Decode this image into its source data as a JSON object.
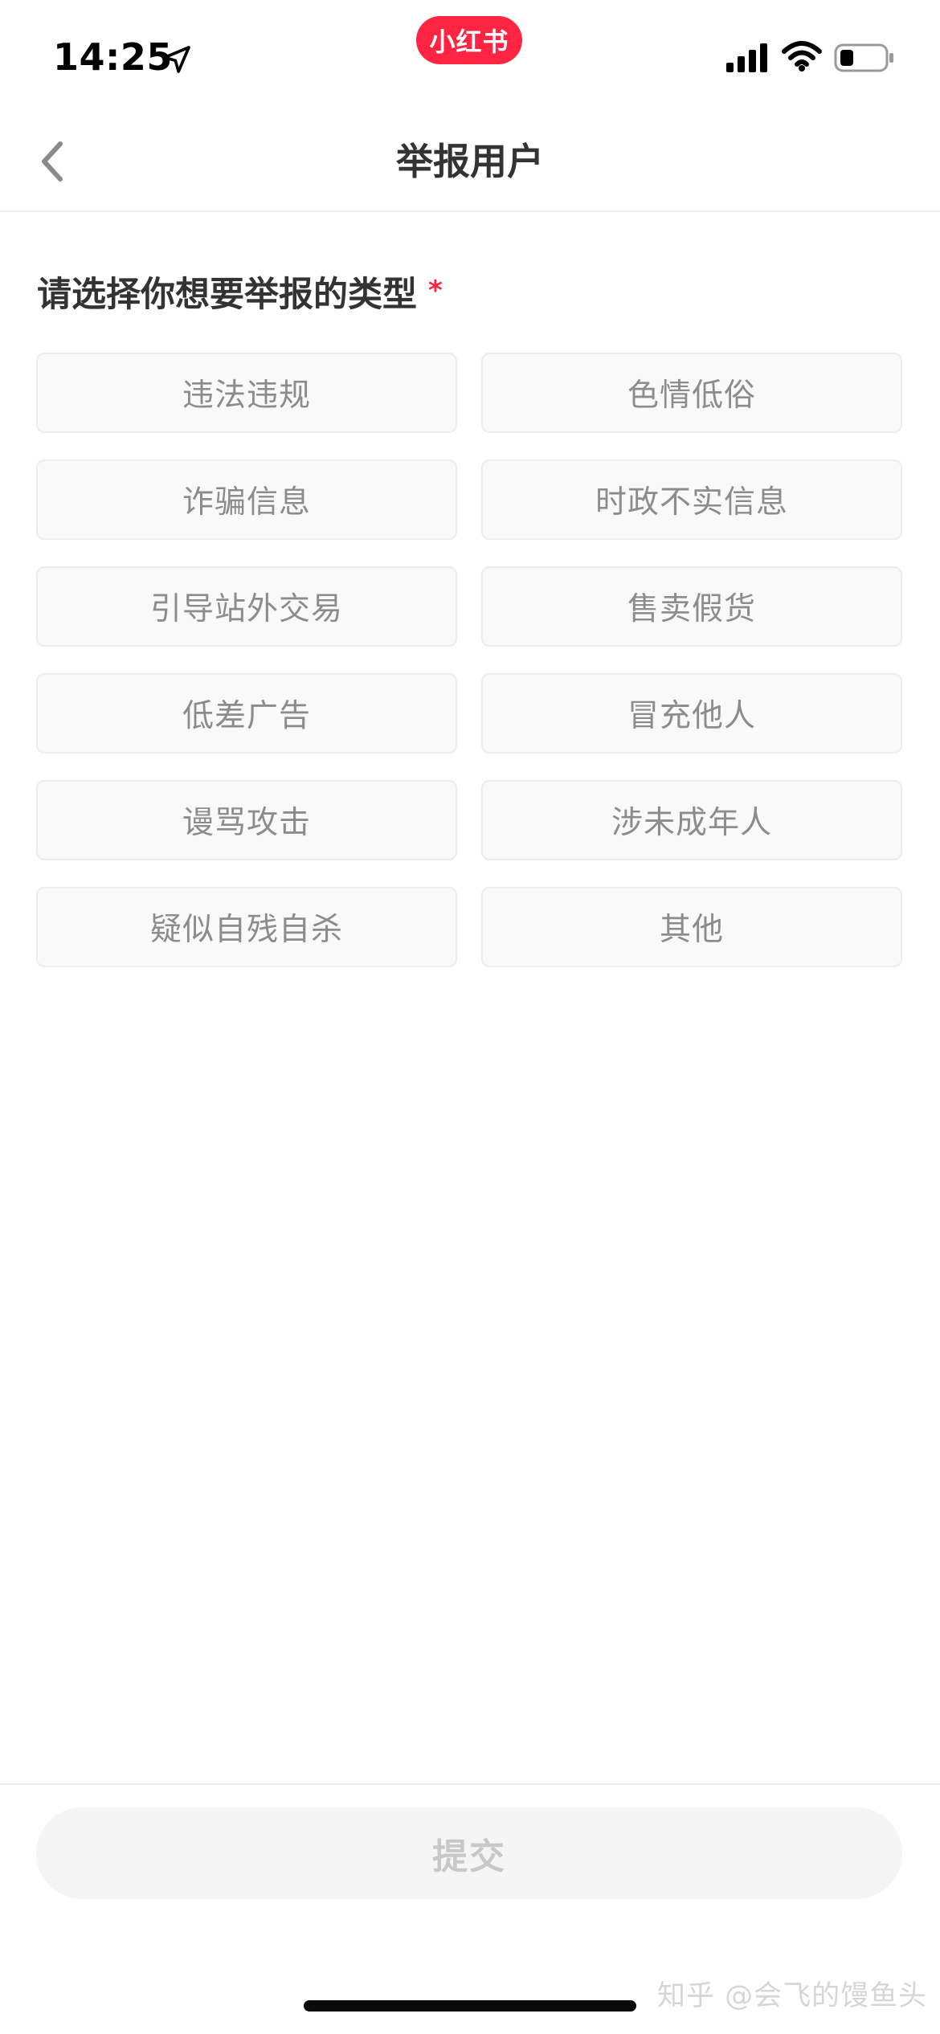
{
  "status_bar": {
    "time": "14:25",
    "app_badge": "小红书",
    "icons": [
      "location-arrow-icon",
      "cellular-signal-icon",
      "wifi-icon",
      "battery-icon"
    ]
  },
  "nav": {
    "back_icon": "chevron-left-icon",
    "title": "举报用户"
  },
  "form": {
    "prompt": "请选择你想要举报的类型",
    "required_mark": "*",
    "options": [
      {
        "label": "违法违规"
      },
      {
        "label": "色情低俗"
      },
      {
        "label": "诈骗信息"
      },
      {
        "label": "时政不实信息"
      },
      {
        "label": "引导站外交易"
      },
      {
        "label": "售卖假货"
      },
      {
        "label": "低差广告"
      },
      {
        "label": "冒充他人"
      },
      {
        "label": "谩骂攻击"
      },
      {
        "label": "涉未成年人"
      },
      {
        "label": "疑似自残自杀"
      },
      {
        "label": "其他"
      }
    ]
  },
  "footer": {
    "submit_label": "提交",
    "submit_enabled": false
  },
  "watermark": "知乎 @会飞的馒鱼头",
  "colors": {
    "accent": "#ff2442",
    "option_bg": "#f9f9f9",
    "option_border": "#ededed",
    "option_text": "#8c8c8c",
    "submit_disabled_bg": "#f5f5f5",
    "submit_disabled_text": "#c8c8c8"
  }
}
